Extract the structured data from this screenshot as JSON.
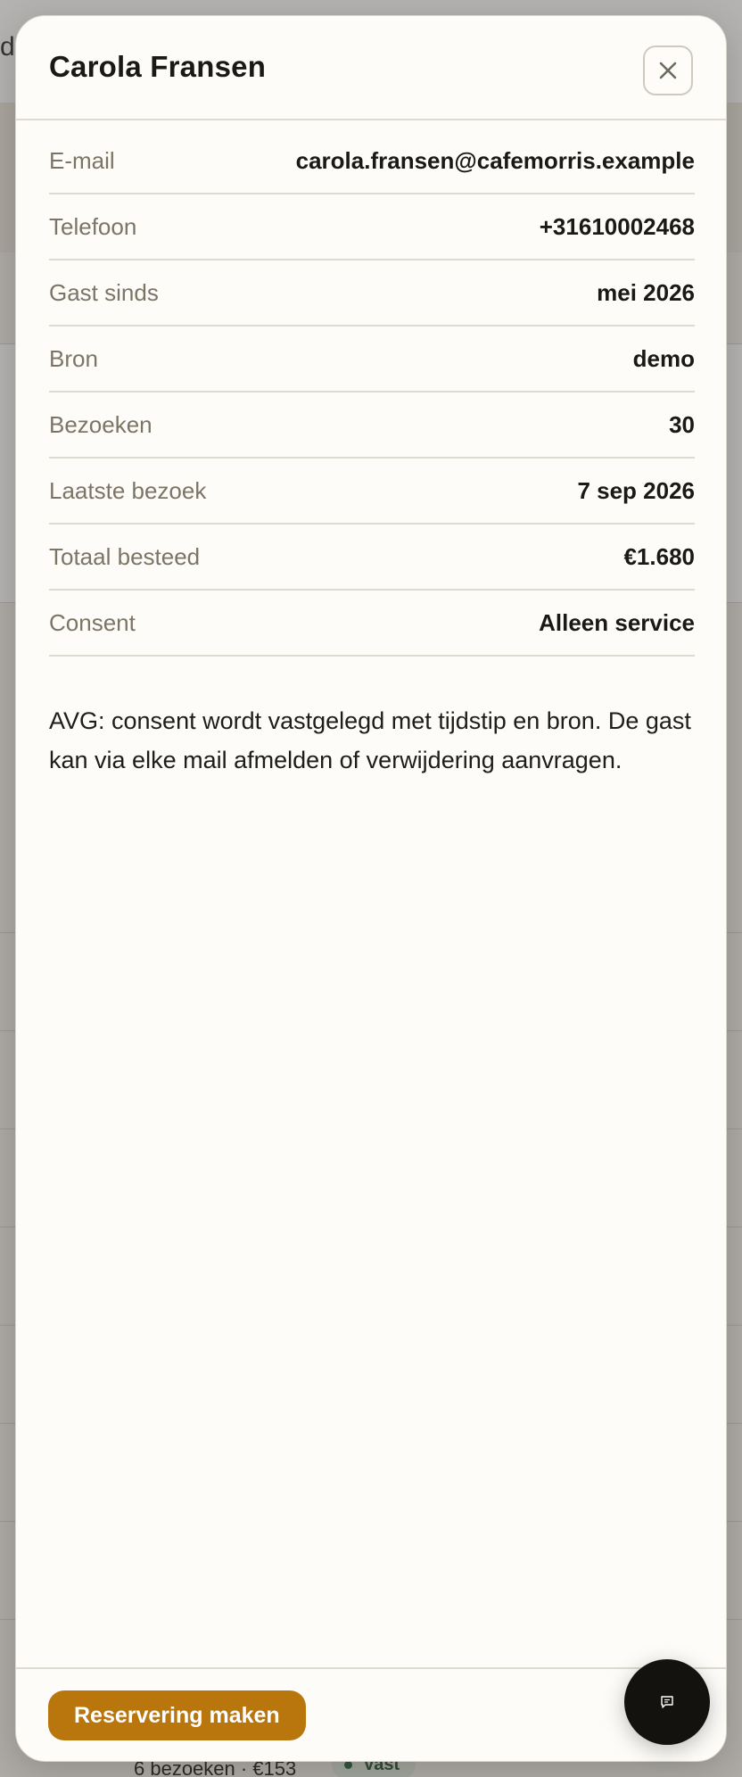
{
  "background": {
    "title_fragment": "d",
    "bottom_text": "6 bezoeken · €153",
    "badge_label": "Vast"
  },
  "modal": {
    "title": "Carola Fransen",
    "close_icon": "close-icon",
    "rows": [
      {
        "label": "E-mail",
        "value": "carola.fransen@cafemorris.example"
      },
      {
        "label": "Telefoon",
        "value": "+31610002468"
      },
      {
        "label": "Gast sinds",
        "value": "mei 2026"
      },
      {
        "label": "Bron",
        "value": "demo"
      },
      {
        "label": "Bezoeken",
        "value": "30"
      },
      {
        "label": "Laatste bezoek",
        "value": "7 sep 2026"
      },
      {
        "label": "Totaal besteed",
        "value": "€1.680"
      },
      {
        "label": "Consent",
        "value": "Alleen service"
      }
    ],
    "avg_note": "AVG: consent wordt vastgelegd met tijdstip en bron. De gast kan via elke mail afmelden of verwijdering aanvragen.",
    "footer": {
      "reserve_button": "Reservering maken"
    }
  },
  "chat_fab": {
    "icon": "chat-icon"
  },
  "colors": {
    "accent": "#b8760d",
    "text": "#1b1915",
    "muted": "#7c7566",
    "modal_bg": "#fdfcf9",
    "fab": "#14120f"
  }
}
